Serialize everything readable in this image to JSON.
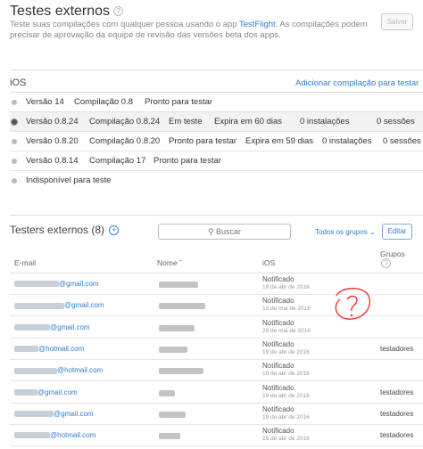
{
  "header": {
    "title": "Testes externos",
    "help": "?",
    "description_pre": "Teste suas compilações com qualquer pessoa usando o app ",
    "description_link": "TestFlight",
    "description_post": ". As compilações podem precisar de aprovação da equipe de revisão das versões beta dos apps.",
    "save_label": "Salvar"
  },
  "ios": {
    "title": "iOS",
    "add_build_label": "Adicionar compilação para testar",
    "builds": [
      {
        "version": "Versão 14",
        "build": "Compilação 0.8",
        "status": "Pronto para testar",
        "expiry": "",
        "installs": "",
        "sessions": "",
        "selected": false
      },
      {
        "version": "Versão 0.8.24",
        "build": "Compilação 0.8.24",
        "status": "Em teste",
        "expiry": "Expira em 60 dias",
        "installs": "0 instalações",
        "sessions": "0 sessões",
        "selected": true
      },
      {
        "version": "Versão 0.8.20",
        "build": "Compilação 0.8.20",
        "status": "Pronto para testar",
        "expiry": "Expira em 59 dias",
        "installs": "0 instalações",
        "sessions": "0 sessões",
        "selected": false
      },
      {
        "version": "Versão 0.8.14",
        "build": "Compilação 17",
        "status": "Pronto para testar",
        "expiry": "",
        "installs": "",
        "sessions": "",
        "selected": false
      },
      {
        "version": "Indisponível para teste",
        "build": "",
        "status": "",
        "expiry": "",
        "installs": "",
        "sessions": "",
        "selected": false
      }
    ]
  },
  "testers": {
    "title": "Testers externos (8)",
    "add": "+",
    "search_placeholder": "Buscar",
    "groups_filter": "Todos os grupos",
    "edit_label": "Editar",
    "columns": {
      "email": "E-mail",
      "name": "Nome",
      "ios": "iOS",
      "groups": "Grupos",
      "groups_help": "?"
    },
    "rows": [
      {
        "email_suffix": "@gmail.com",
        "status": "Notificado",
        "date": "19 de abr de 2016",
        "group": ""
      },
      {
        "email_suffix": "@gmail.com",
        "status": "Notificado",
        "date": "12 de mai de 2016",
        "group": ""
      },
      {
        "email_suffix": "@gmail.com",
        "status": "Notificado",
        "date": "29 de mai de 2016",
        "group": ""
      },
      {
        "email_suffix": "@hotmail.com",
        "status": "Notificado",
        "date": "19 de abr de 2016",
        "group": "testadores"
      },
      {
        "email_suffix": "@hotmail.com",
        "status": "Notificado",
        "date": "19 de abr de 2016",
        "group": ""
      },
      {
        "email_suffix": "@gmail.com",
        "status": "Notificado",
        "date": "19 de abr de 2016",
        "group": "testadores"
      },
      {
        "email_suffix": "@gmail.com",
        "status": "Notificado",
        "date": "19 de abr de 2016",
        "group": "testadores"
      },
      {
        "email_suffix": "@hotmail.com",
        "status": "Notificado",
        "date": "19 de abr de 2016",
        "group": "testadores"
      }
    ]
  },
  "annotation": "?"
}
